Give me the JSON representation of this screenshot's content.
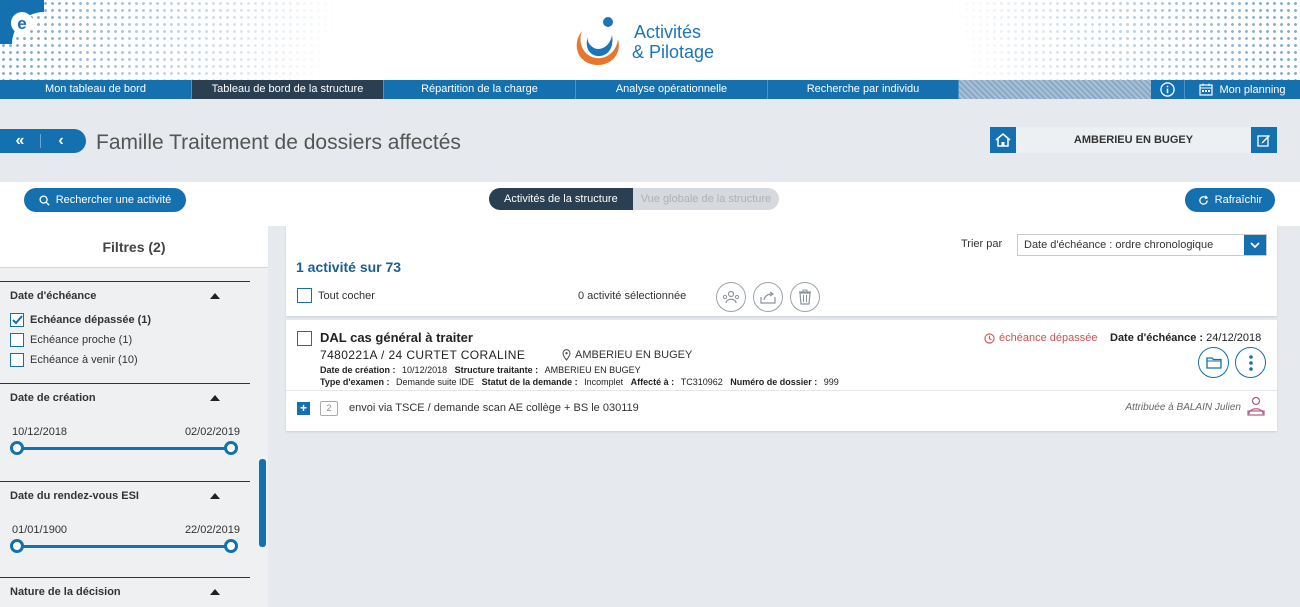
{
  "header": {
    "brand_line1": "Activités",
    "brand_line2": "& Pilotage",
    "logo_letter": "e"
  },
  "nav": {
    "items": [
      {
        "label": "Mon tableau de bord"
      },
      {
        "label": "Tableau de bord de la structure",
        "active": true
      },
      {
        "label": "Répartition de la charge"
      },
      {
        "label": "Analyse opérationnelle"
      },
      {
        "label": "Recherche par individu"
      }
    ],
    "info_icon": "info-icon",
    "planning_label": "Mon planning"
  },
  "title_bar": {
    "page_title": "Famille Traitement de dossiers affectés",
    "structure_name": "AMBERIEU EN BUGEY"
  },
  "toolbar": {
    "search_label": "Rechercher une activité",
    "tab_structure": "Activités de la structure",
    "tab_global": "Vue globale de la structure",
    "refresh_label": "Rafraîchir"
  },
  "sidebar": {
    "filters_title": "Filtres (2)",
    "sections": {
      "echeance": {
        "title": "Date d'échéance",
        "options": [
          {
            "label": "Echéance dépassée (1)",
            "checked": true
          },
          {
            "label": "Echéance proche (1)",
            "checked": false
          },
          {
            "label": "Echéance à venir (10)",
            "checked": false
          }
        ]
      },
      "creation": {
        "title": "Date de création",
        "from": "10/12/2018",
        "to": "02/02/2019"
      },
      "rdv": {
        "title": "Date du rendez-vous ESI",
        "from": "01/01/1900",
        "to": "22/02/2019"
      },
      "decision": {
        "title": "Nature de la décision"
      }
    }
  },
  "list": {
    "count_text": "1 activité sur 73",
    "sort_label": "Trier par",
    "sort_value": "Date d'échéance : ordre chronologique",
    "check_all": "Tout cocher",
    "selected_text": "0 activité sélectionnée"
  },
  "activity": {
    "title": "DAL cas général à traiter",
    "ref": "7480221A / 24  CURTET CORALINE",
    "location": "AMBERIEU EN BUGEY",
    "creation_label": "Date de création :",
    "creation_value": "10/12/2018",
    "structure_label": "Structure traitante :",
    "structure_value": "AMBERIEU EN BUGEY",
    "exam_label": "Type d'examen :",
    "exam_value": "Demande suite IDE",
    "status_label": "Statut de la demande :",
    "status_value": "Incomplet",
    "assigned_label": "Affecté à :",
    "assigned_value": "TC310962",
    "file_label": "Numéro de dossier :",
    "file_value": "999",
    "overdue_text": "échéance dépassée",
    "due_label": "Date d'échéance :",
    "due_value": "24/12/2018",
    "comment_count": "2",
    "note": "envoi via TSCE / demande scan AE collège + BS le 030119",
    "attributed": "Attribuée à BALAIN Julien"
  },
  "colors": {
    "primary": "#1570b0",
    "dark": "#2a3f52",
    "overdue": "#d05050",
    "background": "#e6e9ee"
  }
}
